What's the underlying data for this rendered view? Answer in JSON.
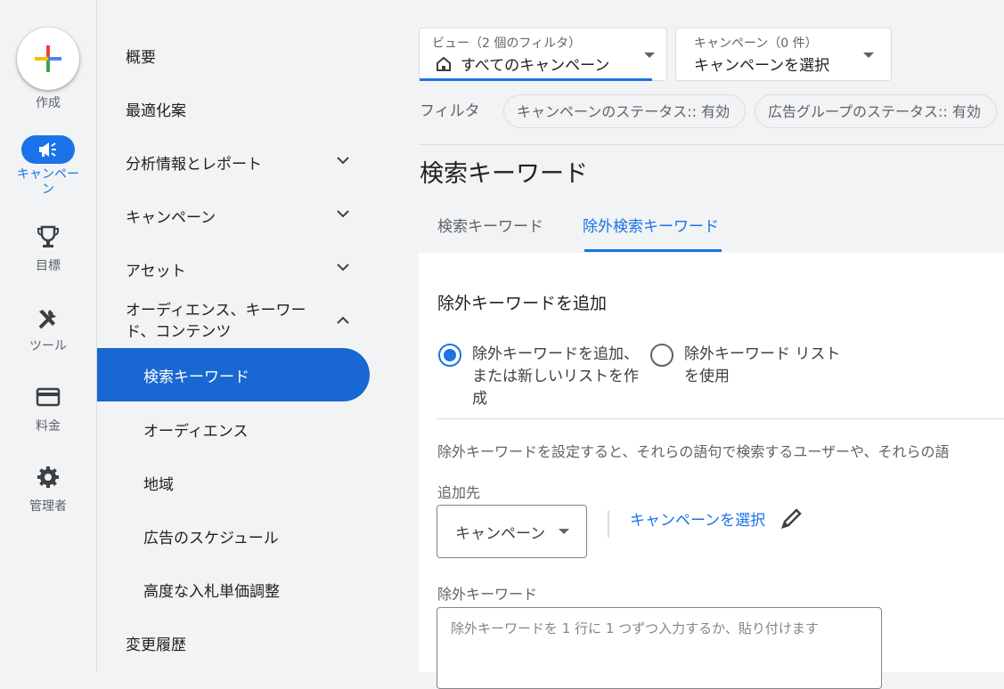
{
  "rail": {
    "create_label": "作成",
    "campaigns_label": "キャンペーン",
    "goals_label": "目標",
    "tools_label": "ツール",
    "billing_label": "料金",
    "admin_label": "管理者"
  },
  "nav": {
    "overview": "概要",
    "recommendations": "最適化案",
    "insights_reports": "分析情報とレポート",
    "campaigns": "キャンペーン",
    "assets": "アセット",
    "audiences_keywords": "オーディエンス、キーワード、コンテンツ",
    "search_keywords": "検索キーワード",
    "audiences": "オーディエンス",
    "locations": "地域",
    "ad_schedule": "広告のスケジュール",
    "bid_adjustments": "高度な入札単価調整",
    "change_history": "変更履歴"
  },
  "header": {
    "view_small": "ビュー（2 個のフィルタ）",
    "view_main": "すべてのキャンペーン",
    "campaign_small": "キャンペーン（0 件）",
    "campaign_main": "キャンペーンを選択",
    "filter_label": "フィルタ",
    "chip1": "キャンペーンのステータス:: 有効",
    "chip2": "広告グループのステータス:: 有効"
  },
  "page": {
    "title": "検索キーワード",
    "tab1": "検索キーワード",
    "tab2": "除外検索キーワード"
  },
  "form": {
    "section_title": "除外キーワードを追加",
    "radio1_line1": "除外キーワードを追加、",
    "radio1_line2": "または新しいリストを作",
    "radio1_line3": "成",
    "radio2_line1": "除外キーワード リスト",
    "radio2_line2": "を使用",
    "description": "除外キーワードを設定すると、それらの語句で検索するユーザーや、それらの語",
    "add_to_label": "追加先",
    "add_to_value": "キャンペーン",
    "select_campaign_link": "キャンペーンを選択",
    "keywords_label": "除外キーワード",
    "keywords_placeholder": "除外キーワードを 1 行に 1 つずつ入力するか、貼り付けます"
  },
  "colors": {
    "accent": "#1a73e8",
    "active_nav": "#1967d2"
  }
}
